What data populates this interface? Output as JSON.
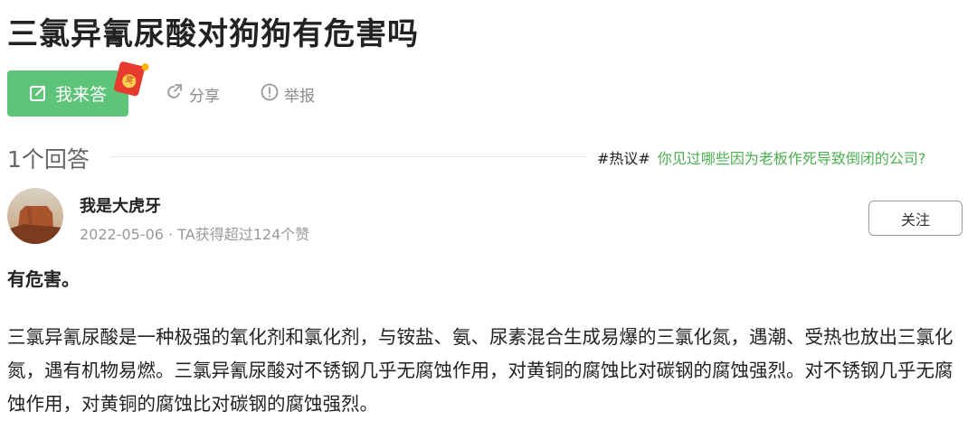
{
  "question": {
    "title": "三氯异氰尿酸对狗狗有危害吗"
  },
  "actions": {
    "answer_label": "我来答",
    "share_label": "分享",
    "report_label": "举报",
    "redpacket_glyph": "奖"
  },
  "answers_header": {
    "count_label": "1个回答",
    "hot_tag": "#热议#",
    "hot_topic": "你见过哪些因为老板作死导致倒闭的公司?"
  },
  "answer": {
    "author": "我是大虎牙",
    "date": "2022-05-06",
    "separator": "·",
    "likes_text": "TA获得超过124个赞",
    "follow_label": "关注",
    "lead": "有危害。",
    "body": "三氯异氰尿酸是一种极强的氧化剂和氯化剂，与铵盐、氨、尿素混合生成易爆的三氯化氮，遇潮、受热也放出三氯化氮，遇有机物易燃。三氯异氰尿酸对不锈钢几乎无腐蚀作用，对黄铜的腐蚀比对碳钢的腐蚀强烈。对不锈钢几乎无腐蚀作用，对黄铜的腐蚀比对碳钢的腐蚀强烈。"
  },
  "colors": {
    "accent_green": "#5dc47a",
    "link_green": "#4caf50",
    "redpacket_red": "#e73b2f"
  },
  "icons": {
    "answer": "edit-icon",
    "share": "share-icon",
    "report": "report-icon"
  }
}
